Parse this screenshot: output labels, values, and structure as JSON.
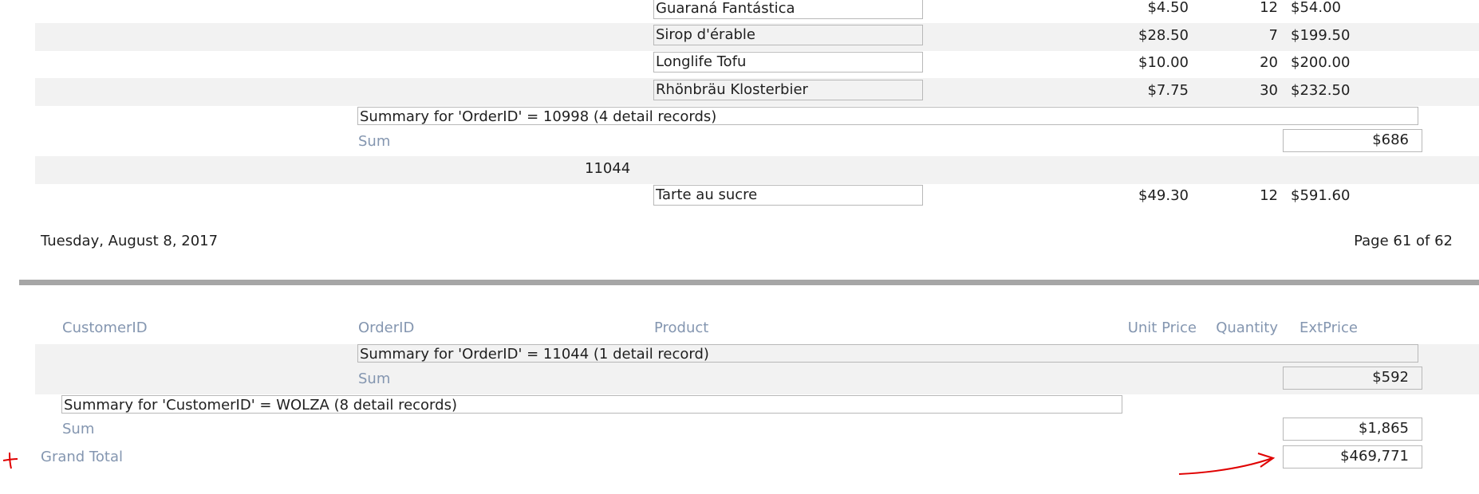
{
  "page1": {
    "rows": [
      {
        "product": "Guaraná Fantástica",
        "unit_price": "$4.50",
        "quantity": "12",
        "ext_price": "$54.00"
      },
      {
        "product": "Sirop d'érable",
        "unit_price": "$28.50",
        "quantity": "7",
        "ext_price": "$199.50"
      },
      {
        "product": "Longlife Tofu",
        "unit_price": "$10.00",
        "quantity": "20",
        "ext_price": "$200.00"
      },
      {
        "product": "Rhönbräu Klosterbier",
        "unit_price": "$7.75",
        "quantity": "30",
        "ext_price": "$232.50"
      }
    ],
    "summary_order": "Summary for 'OrderID' =  10998 (4 detail records)",
    "sum_label": "Sum",
    "sum_value": "$686",
    "order_id": "11044",
    "last_row": {
      "product": "Tarte au sucre",
      "unit_price": "$49.30",
      "quantity": "12",
      "ext_price": "$591.60"
    },
    "footer_date": "Tuesday, August 8, 2017",
    "footer_page": "Page 61 of 62"
  },
  "page2": {
    "headers": {
      "customer_id": "CustomerID",
      "order_id": "OrderID",
      "product": "Product",
      "unit_price": "Unit Price",
      "quantity": "Quantity",
      "ext_price": "ExtPrice"
    },
    "summary_order": "Summary for 'OrderID' =  11044 (1 detail record)",
    "order_sum_label": "Sum",
    "order_sum_value": "$592",
    "summary_customer": "Summary for 'CustomerID' =  WOLZA (8 detail records)",
    "customer_sum_label": "Sum",
    "customer_sum_value": "$1,865",
    "grand_total_label": "Grand Total",
    "grand_total_value": "$469,771"
  },
  "colors": {
    "band": "#f2f2f2",
    "label": "#8496b0",
    "divider": "#a6a6a6",
    "annotation": "#e00000"
  }
}
